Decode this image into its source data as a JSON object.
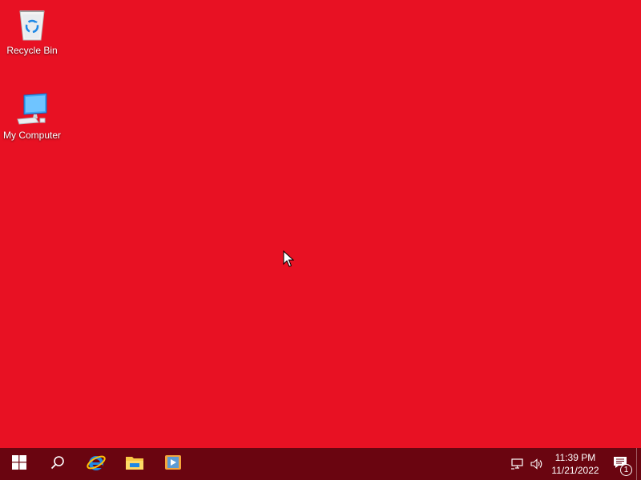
{
  "desktop": {
    "background_color": "#e81123",
    "icons": [
      {
        "label": "Recycle Bin",
        "icon": "recycle-bin-icon"
      },
      {
        "label": "My Computer",
        "icon": "computer-icon"
      }
    ]
  },
  "taskbar": {
    "background_color": "#6a0510",
    "pinned": [
      {
        "name": "start",
        "icon": "windows-logo-icon"
      },
      {
        "name": "search",
        "icon": "search-icon"
      },
      {
        "name": "internet-explorer",
        "icon": "internet-explorer-icon"
      },
      {
        "name": "file-explorer",
        "icon": "folder-icon"
      },
      {
        "name": "media-player",
        "icon": "media-player-icon"
      }
    ],
    "tray": {
      "icons": [
        "network-icon",
        "volume-icon"
      ],
      "time": "11:39 PM",
      "date": "11/21/2022",
      "notification_count": "1"
    }
  }
}
